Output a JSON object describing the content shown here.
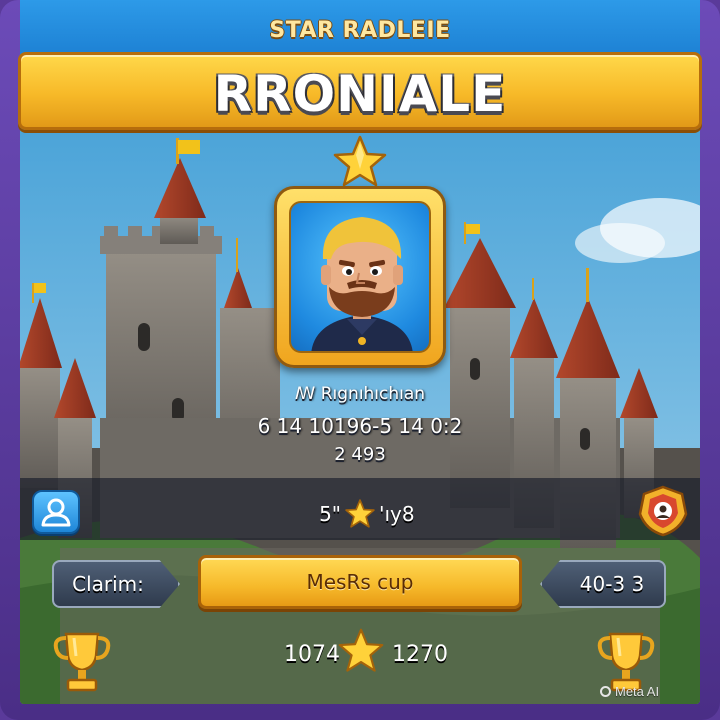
{
  "header": {
    "subtitle": "STAR RADLEIE",
    "title": "RRONIALE"
  },
  "profile": {
    "name": "ꟿ  Rıgnıhıchıan",
    "stats": "6 14 10196-5 14 0:2",
    "level": "2 493"
  },
  "mid_bar": {
    "left_value": "5\"",
    "right_value": "'ıy8"
  },
  "actions": {
    "claim_label": "Clarim:",
    "main_label": "MesRs cup",
    "score_label": "40-3 3"
  },
  "footer": {
    "left_score": "1074",
    "right_score": "1270"
  },
  "watermark": "Meta AI",
  "colors": {
    "gold": "#f6b92a",
    "sky": "#1c7fd2",
    "frame_purple": "#5a3a9a",
    "stone": "#7e7a74"
  },
  "icons": {
    "top_star": "star-icon",
    "friend_button": "user-icon",
    "clan_badge": "crest-icon",
    "trophies": "trophy-icon"
  }
}
